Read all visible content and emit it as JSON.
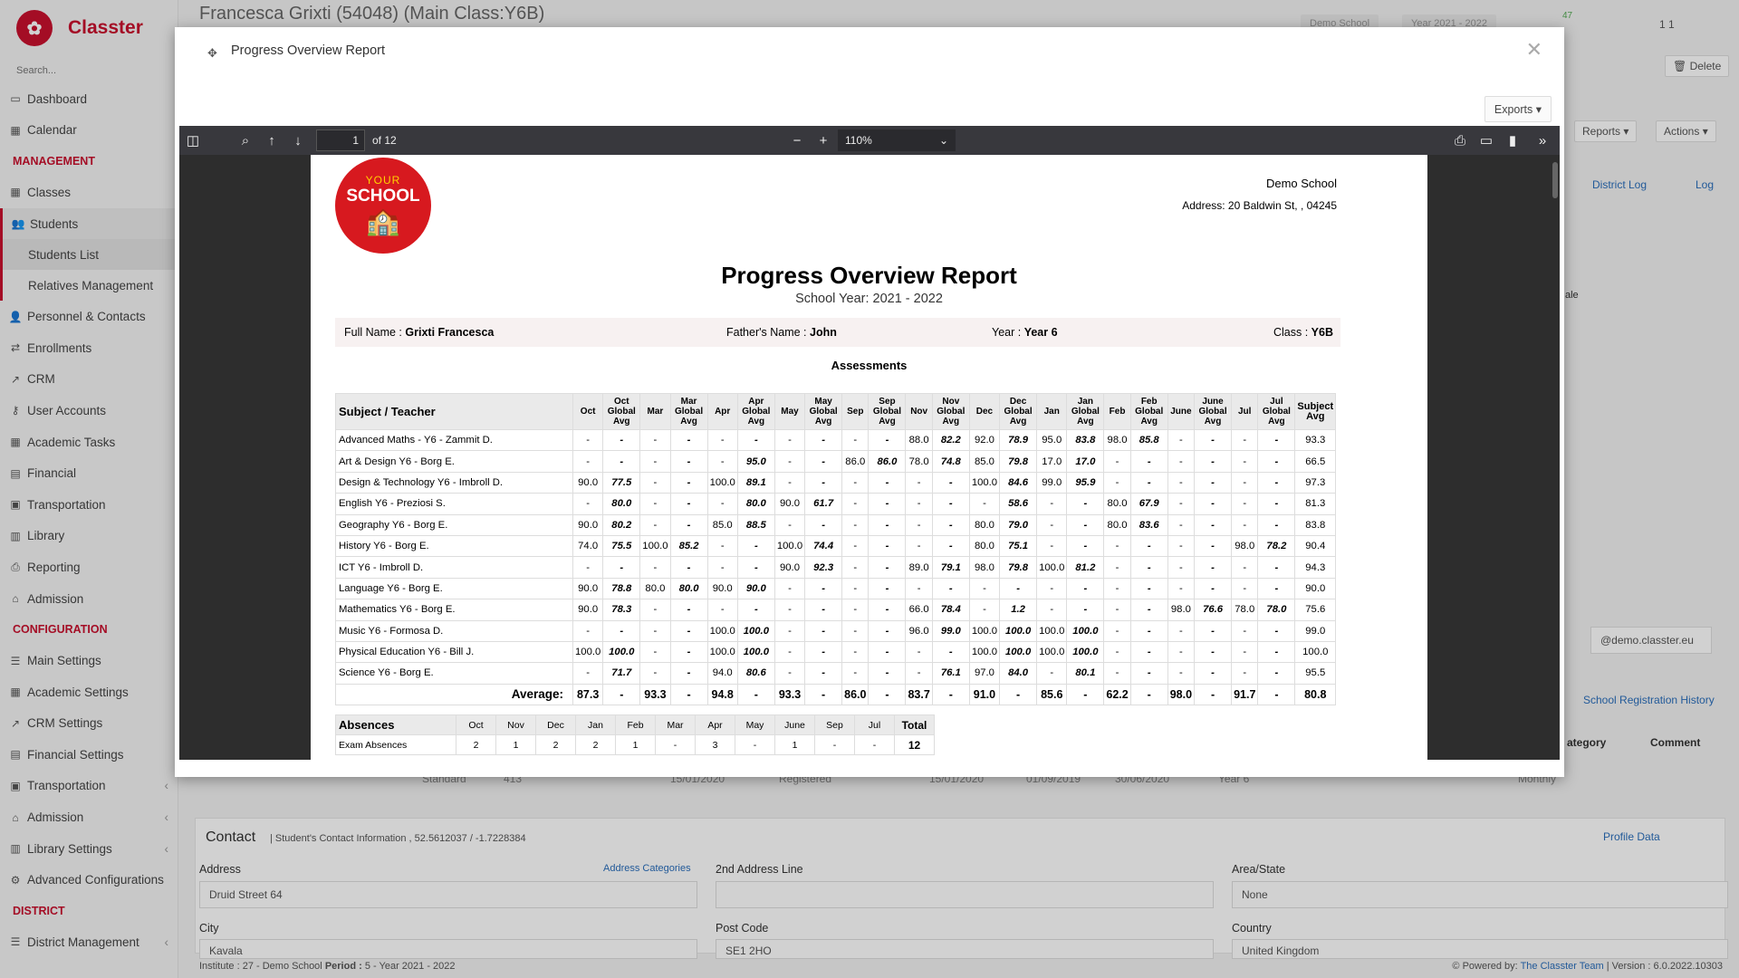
{
  "app": {
    "name": "Classter",
    "search_placeholder": "Search..."
  },
  "sidebar": {
    "items": [
      {
        "type": "item",
        "label": "Dashboard",
        "icon": "monitor-icon"
      },
      {
        "type": "item",
        "label": "Calendar",
        "icon": "calendar-icon"
      },
      {
        "type": "section",
        "label": "MANAGEMENT"
      },
      {
        "type": "item",
        "label": "Classes",
        "icon": "grid-icon"
      },
      {
        "type": "item",
        "label": "Students",
        "icon": "users-icon",
        "active": true
      },
      {
        "type": "sub",
        "label": "Students List",
        "active": true
      },
      {
        "type": "sub",
        "label": "Relatives Management"
      },
      {
        "type": "item",
        "label": "Personnel & Contacts",
        "icon": "user-icon"
      },
      {
        "type": "item",
        "label": "Enrollments",
        "icon": "exchange-icon"
      },
      {
        "type": "item",
        "label": "CRM",
        "icon": "chart-icon"
      },
      {
        "type": "item",
        "label": "User Accounts",
        "icon": "key-icon"
      },
      {
        "type": "item",
        "label": "Academic Tasks",
        "icon": "grid-icon"
      },
      {
        "type": "item",
        "label": "Financial",
        "icon": "money-icon"
      },
      {
        "type": "item",
        "label": "Transportation",
        "icon": "bus-icon"
      },
      {
        "type": "item",
        "label": "Library",
        "icon": "book-icon"
      },
      {
        "type": "item",
        "label": "Reporting",
        "icon": "print-icon"
      },
      {
        "type": "item",
        "label": "Admission",
        "icon": "bank-icon"
      },
      {
        "type": "section",
        "label": "CONFIGURATION"
      },
      {
        "type": "item",
        "label": "Main Settings",
        "icon": "sliders-icon"
      },
      {
        "type": "item",
        "label": "Academic Settings",
        "icon": "grid-icon"
      },
      {
        "type": "item",
        "label": "CRM Settings",
        "icon": "chart-icon"
      },
      {
        "type": "item",
        "label": "Financial Settings",
        "icon": "money-icon"
      },
      {
        "type": "item",
        "label": "Transportation",
        "icon": "bus-icon",
        "arrow": true
      },
      {
        "type": "item",
        "label": "Admission",
        "icon": "bank-icon",
        "arrow": true
      },
      {
        "type": "item",
        "label": "Library Settings",
        "icon": "book-icon",
        "arrow": true
      },
      {
        "type": "item",
        "label": "Advanced Configurations",
        "icon": "gear-icon"
      },
      {
        "type": "section",
        "label": "DISTRICT"
      },
      {
        "type": "item",
        "label": "District Management",
        "icon": "list-icon",
        "arrow": true
      }
    ]
  },
  "header": {
    "title": "Francesca Grixti (54048) (Main Class:Y6B)",
    "school_chip": "Demo School",
    "year_chip": "Year 2021 - 2022",
    "badge": "47",
    "user_count": "1 1"
  },
  "background": {
    "delete_btn": "Delete",
    "reports_btn": "Reports",
    "actions_btn": "Actions",
    "district_log": "District Log",
    "log": "Log",
    "side_text": "ale",
    "email_suffix": "@demo.classter.eu",
    "school_reg": "School Registration History",
    "category": "ategory",
    "comment": "Comment",
    "row_type": "Standard",
    "row_num": "413",
    "row_date1": "15/01/2020",
    "row_status": "Registered",
    "row_date2": "15/01/2020",
    "row_date3": "01/09/2019",
    "row_date4": "30/06/2020",
    "row_year": "Year 6",
    "row_freq": "Monthly",
    "contact_title": "Contact",
    "contact_sub": "| Student's Contact Information , 52.5612037 / -1.7228384",
    "profile_data": "Profile Data",
    "address_label": "Address",
    "address_categories": "Address Categories",
    "address_value": "Druid Street 64",
    "address2_label": "2nd Address Line",
    "area_label": "Area/State",
    "area_value": "None",
    "city_label": "City",
    "city_value": "Kavala",
    "post_label": "Post Code",
    "post_value": "SE1 2HO",
    "country_label": "Country",
    "country_value": "United Kingdom"
  },
  "footer": {
    "left_institute_label": "Institute :",
    "left_institute": "27 - Demo School",
    "left_period_label": "Period :",
    "left_period": "5 - Year 2021 - 2022",
    "right_powered": "Powered by:",
    "right_team": "The Classter Team",
    "right_version": "| Version : 6.0.2022.10303"
  },
  "modal": {
    "title": "Progress Overview Report",
    "exports_label": "Exports"
  },
  "viewer": {
    "page_current": "1",
    "page_total": "of 12",
    "zoom": "110%"
  },
  "report": {
    "school_name": "Demo School",
    "school_address": "Address: 20 Baldwin St, , 04245",
    "logo_text_top": "YOUR",
    "logo_text_main": "SCHOOL",
    "title": "Progress Overview Report",
    "school_year": "School Year: 2021 - 2022",
    "full_name_label": "Full Name :",
    "full_name": "Grixti Francesca",
    "father_label": "Father's Name :",
    "father": "John",
    "year_label": "Year :",
    "year": "Year 6",
    "class_label": "Class :",
    "class": "Y6B",
    "assessments_title": "Assessments",
    "subject_header": "Subject / Teacher",
    "columns": [
      {
        "label": "Oct",
        "global": false
      },
      {
        "label": "Oct Global Avg",
        "global": true
      },
      {
        "label": "Mar",
        "global": false
      },
      {
        "label": "Mar Global Avg",
        "global": true
      },
      {
        "label": "Apr",
        "global": false
      },
      {
        "label": "Apr Global Avg",
        "global": true
      },
      {
        "label": "May",
        "global": false
      },
      {
        "label": "May Global Avg",
        "global": true
      },
      {
        "label": "Sep",
        "global": false
      },
      {
        "label": "Sep Global Avg",
        "global": true
      },
      {
        "label": "Nov",
        "global": false
      },
      {
        "label": "Nov Global Avg",
        "global": true
      },
      {
        "label": "Dec",
        "global": false
      },
      {
        "label": "Dec Global Avg",
        "global": true
      },
      {
        "label": "Jan",
        "global": false
      },
      {
        "label": "Jan Global Avg",
        "global": true
      },
      {
        "label": "Feb",
        "global": false
      },
      {
        "label": "Feb Global Avg",
        "global": true
      },
      {
        "label": "June",
        "global": false
      },
      {
        "label": "June Global Avg",
        "global": true
      },
      {
        "label": "Jul",
        "global": false
      },
      {
        "label": "Jul Global Avg",
        "global": true
      }
    ],
    "subject_avg_header": "Subject Avg",
    "rows": [
      {
        "subject": "Advanced Maths - Y6 - Zammit D.",
        "values": [
          "-",
          "-",
          "-",
          "-",
          "-",
          "-",
          "-",
          "-",
          "-",
          "-",
          "88.0",
          "82.2",
          "92.0",
          "78.9",
          "95.0",
          "83.8",
          "98.0",
          "85.8",
          "-",
          "-",
          "-",
          "-"
        ],
        "avg": "93.3"
      },
      {
        "subject": "Art & Design Y6 - Borg E.",
        "values": [
          "-",
          "-",
          "-",
          "-",
          "-",
          "95.0",
          "-",
          "-",
          "86.0",
          "86.0",
          "78.0",
          "74.8",
          "85.0",
          "79.8",
          "17.0",
          "17.0",
          "-",
          "-",
          "-",
          "-",
          "-",
          "-"
        ],
        "avg": "66.5"
      },
      {
        "subject": "Design & Technology Y6 - Imbroll D.",
        "values": [
          "90.0",
          "77.5",
          "-",
          "-",
          "100.0",
          "89.1",
          "-",
          "-",
          "-",
          "-",
          "-",
          "-",
          "100.0",
          "84.6",
          "99.0",
          "95.9",
          "-",
          "-",
          "-",
          "-",
          "-",
          "-"
        ],
        "avg": "97.3"
      },
      {
        "subject": "English Y6 - Preziosi S.",
        "values": [
          "-",
          "80.0",
          "-",
          "-",
          "-",
          "80.0",
          "90.0",
          "61.7",
          "-",
          "-",
          "-",
          "-",
          "-",
          "58.6",
          "-",
          "-",
          "80.0",
          "67.9",
          "-",
          "-",
          "-",
          "-"
        ],
        "avg": "81.3"
      },
      {
        "subject": "Geography Y6 - Borg E.",
        "values": [
          "90.0",
          "80.2",
          "-",
          "-",
          "85.0",
          "88.5",
          "-",
          "-",
          "-",
          "-",
          "-",
          "-",
          "80.0",
          "79.0",
          "-",
          "-",
          "80.0",
          "83.6",
          "-",
          "-",
          "-",
          "-"
        ],
        "avg": "83.8"
      },
      {
        "subject": "History Y6 - Borg E.",
        "values": [
          "74.0",
          "75.5",
          "100.0",
          "85.2",
          "-",
          "-",
          "100.0",
          "74.4",
          "-",
          "-",
          "-",
          "-",
          "80.0",
          "75.1",
          "-",
          "-",
          "-",
          "-",
          "-",
          "-",
          "98.0",
          "78.2"
        ],
        "avg": "90.4"
      },
      {
        "subject": "ICT Y6 - Imbroll D.",
        "values": [
          "-",
          "-",
          "-",
          "-",
          "-",
          "-",
          "90.0",
          "92.3",
          "-",
          "-",
          "89.0",
          "79.1",
          "98.0",
          "79.8",
          "100.0",
          "81.2",
          "-",
          "-",
          "-",
          "-",
          "-",
          "-"
        ],
        "avg": "94.3"
      },
      {
        "subject": "Language Y6 - Borg E.",
        "values": [
          "90.0",
          "78.8",
          "80.0",
          "80.0",
          "90.0",
          "90.0",
          "-",
          "-",
          "-",
          "-",
          "-",
          "-",
          "-",
          "-",
          "-",
          "-",
          "-",
          "-",
          "-",
          "-",
          "-",
          "-"
        ],
        "avg": "90.0"
      },
      {
        "subject": "Mathematics  Y6 - Borg E.",
        "values": [
          "90.0",
          "78.3",
          "-",
          "-",
          "-",
          "-",
          "-",
          "-",
          "-",
          "-",
          "66.0",
          "78.4",
          "-",
          "1.2",
          "-",
          "-",
          "-",
          "-",
          "98.0",
          "76.6",
          "78.0",
          "78.0"
        ],
        "avg": "75.6"
      },
      {
        "subject": "Music Y6 - Formosa D.",
        "values": [
          "-",
          "-",
          "-",
          "-",
          "100.0",
          "100.0",
          "-",
          "-",
          "-",
          "-",
          "96.0",
          "99.0",
          "100.0",
          "100.0",
          "100.0",
          "100.0",
          "-",
          "-",
          "-",
          "-",
          "-",
          "-"
        ],
        "avg": "99.0"
      },
      {
        "subject": "Physical Education Y6 - Bill J.",
        "values": [
          "100.0",
          "100.0",
          "-",
          "-",
          "100.0",
          "100.0",
          "-",
          "-",
          "-",
          "-",
          "-",
          "-",
          "100.0",
          "100.0",
          "100.0",
          "100.0",
          "-",
          "-",
          "-",
          "-",
          "-",
          "-"
        ],
        "avg": "100.0"
      },
      {
        "subject": "Science Y6 - Borg E.",
        "values": [
          "-",
          "71.7",
          "-",
          "-",
          "94.0",
          "80.6",
          "-",
          "-",
          "-",
          "-",
          "-",
          "76.1",
          "97.0",
          "84.0",
          "-",
          "80.1",
          "-",
          "-",
          "-",
          "-",
          "-",
          "-"
        ],
        "avg": "95.5"
      }
    ],
    "average_label": "Average:",
    "average_values": [
      "87.3",
      "-",
      "93.3",
      "-",
      "94.8",
      "-",
      "93.3",
      "-",
      "86.0",
      "-",
      "83.7",
      "-",
      "91.0",
      "-",
      "85.6",
      "-",
      "62.2",
      "-",
      "98.0",
      "-",
      "91.7",
      "-"
    ],
    "average_total": "80.8",
    "absences": {
      "title": "Absences",
      "months": [
        "Oct",
        "Nov",
        "Dec",
        "Jan",
        "Feb",
        "Mar",
        "Apr",
        "May",
        "June",
        "Sep",
        "Jul"
      ],
      "total_label": "Total",
      "row_label": "Exam Absences",
      "values": [
        "2",
        "1",
        "2",
        "2",
        "1",
        "-",
        "3",
        "-",
        "1",
        "-",
        "-"
      ],
      "total": "12"
    }
  }
}
